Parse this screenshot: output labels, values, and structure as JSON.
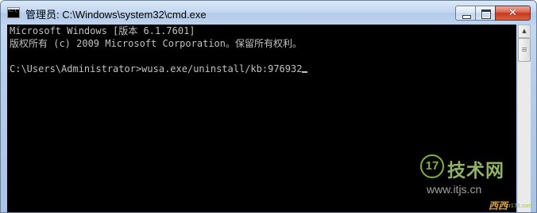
{
  "window": {
    "title": "管理员: C:\\Windows\\system32\\cmd.exe",
    "icon": "cmd-icon",
    "icon_text": "C:\\",
    "controls": {
      "minimize_icon": "minimize-icon",
      "maximize_icon": "maximize-icon",
      "close_icon": "close-icon",
      "close_glyph": "✕"
    }
  },
  "console": {
    "lines": [
      "Microsoft Windows [版本 6.1.7601]",
      "版权所有 (c) 2009 Microsoft Corporation。保留所有权利。",
      "",
      "C:\\Users\\Administrator>wusa.exe/uninstall/kb:976932"
    ],
    "text_color": "#c0c0c0",
    "background": "#000000"
  },
  "scrollbar": {
    "up_arrow": "▲"
  },
  "watermark": {
    "logo_text": "17",
    "brand": "技术网",
    "url": "www.itjs.cn",
    "badge": "西西",
    "sub": "cr173.com"
  }
}
